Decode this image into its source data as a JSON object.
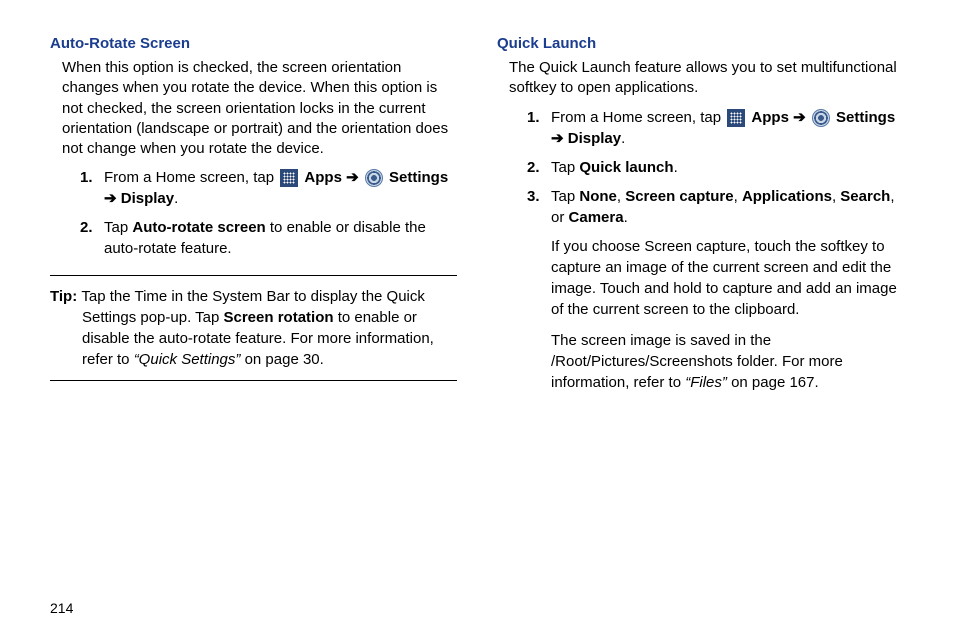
{
  "left": {
    "heading": "Auto-Rotate Screen",
    "intro": "When this option is checked, the screen orientation changes when you rotate the device. When this option is not checked, the screen orientation locks in the current orientation (landscape or portrait) and the orientation does not change when you rotate the device.",
    "steps": {
      "s1_num": "1.",
      "s1_pre": "From a Home screen, tap ",
      "s1_apps": "Apps",
      "s1_arrow1": " ➔ ",
      "s1_settings": "Settings",
      "s1_arrow2": " ➔ ",
      "s1_display": "Display",
      "s1_end": ".",
      "s2_num": "2.",
      "s2_pre": "Tap ",
      "s2_bold": "Auto-rotate screen",
      "s2_post": " to enable or disable the auto-rotate feature."
    },
    "tip": {
      "label": "Tip: ",
      "pre": "Tap the Time in the System Bar to display the Quick Settings pop-up. Tap ",
      "bold": "Screen rotation",
      "mid": " to enable or disable the auto-rotate feature. For more information, refer to ",
      "italic": "“Quick Settings” ",
      "post": " on page 30."
    }
  },
  "right": {
    "heading": "Quick Launch",
    "intro": "The Quick Launch feature allows you to set multifunctional softkey to open applications.",
    "steps": {
      "s1_num": "1.",
      "s1_pre": "From a Home screen, tap ",
      "s1_apps": "Apps",
      "s1_arrow1": " ➔ ",
      "s1_settings": "Settings",
      "s1_arrow2": " ➔ ",
      "s1_display": "Display",
      "s1_end": ".",
      "s2_num": "2.",
      "s2_pre": "Tap ",
      "s2_bold": "Quick launch",
      "s2_end": ".",
      "s3_num": "3.",
      "s3_pre": "Tap ",
      "s3_none": "None",
      "s3_c1": ", ",
      "s3_sc": "Screen capture",
      "s3_c2": ", ",
      "s3_apps": "Applications",
      "s3_c3": ", ",
      "s3_search": "Search",
      "s3_c4": ", or ",
      "s3_camera": "Camera",
      "s3_end": "."
    },
    "sub1": "If you choose Screen capture, touch the softkey to capture an image of the current screen and edit the image. Touch and hold to capture and add an image of the current screen to the clipboard.",
    "sub2_pre": "The screen image is saved in the /Root/Pictures/Screenshots folder. For more information, refer to ",
    "sub2_italic": "“Files” ",
    "sub2_post": " on page 167."
  },
  "page_number": "214"
}
